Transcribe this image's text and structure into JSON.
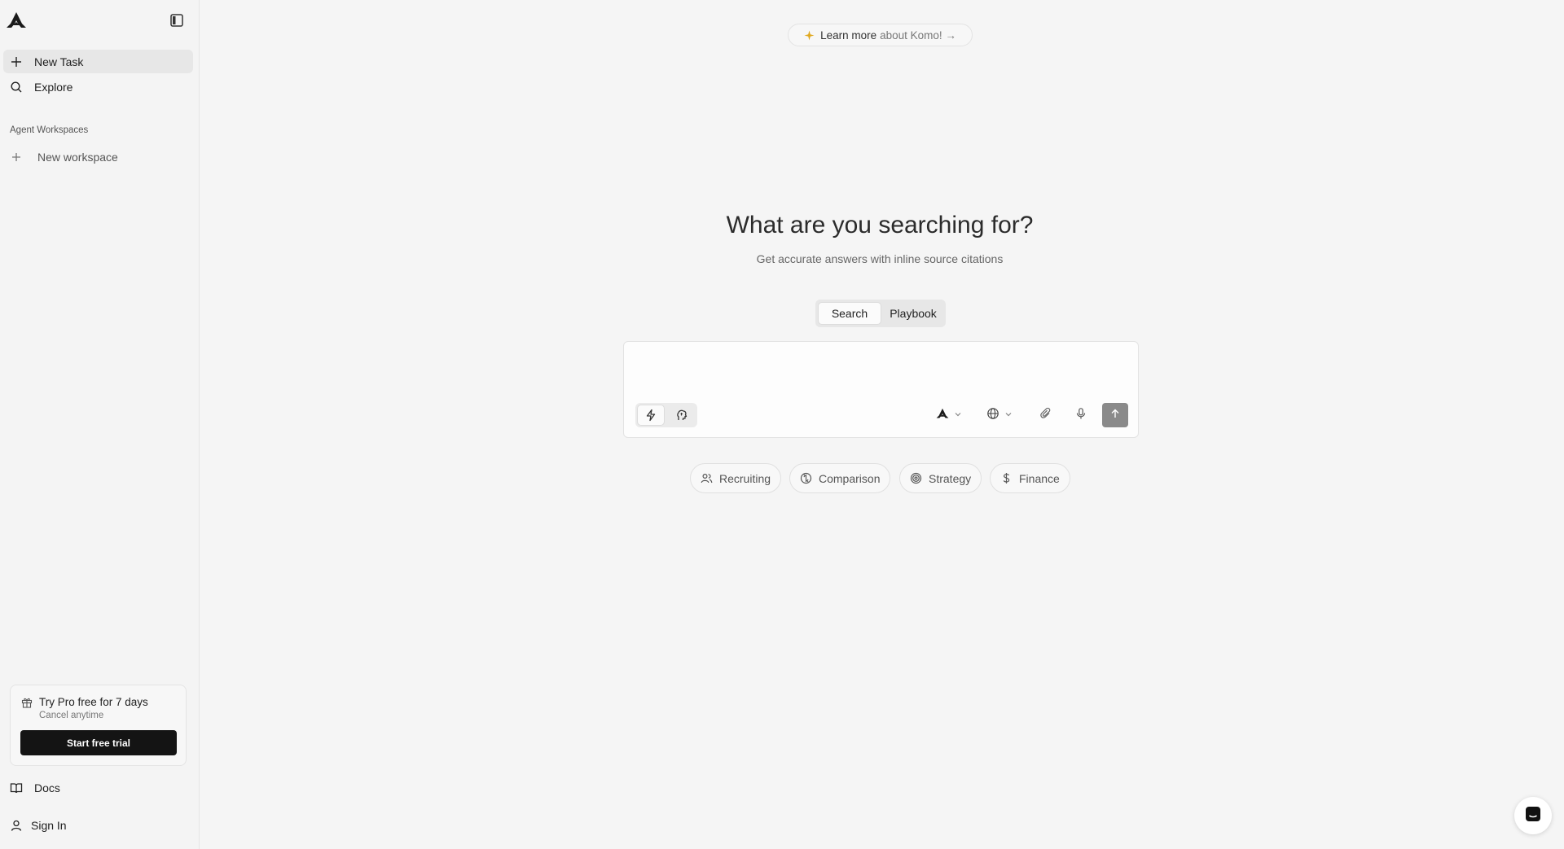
{
  "sidebar": {
    "nav": [
      {
        "label": "New Task",
        "icon": "plus-icon"
      },
      {
        "label": "Explore",
        "icon": "search-icon"
      }
    ],
    "workspaces_label": "Agent Workspaces",
    "new_workspace_label": "New workspace",
    "promo": {
      "title": "Try Pro free for 7 days",
      "subtitle": "Cancel anytime",
      "button": "Start free trial",
      "icon": "gift-icon"
    },
    "footer": [
      {
        "label": "Docs",
        "icon": "book-icon"
      },
      {
        "label": "Sign In",
        "icon": "user-icon"
      }
    ]
  },
  "banner": {
    "bold": "Learn more",
    "rest": "about Komo! →",
    "icon": "sparkle-icon"
  },
  "hero": {
    "title": "What are you searching for?",
    "subtitle": "Get accurate answers with inline source citations"
  },
  "mode_tabs": [
    "Search",
    "Playbook"
  ],
  "composer": {
    "placeholder": "",
    "tools": [
      "komo-model-icon",
      "globe-icon",
      "paperclip-icon",
      "microphone-icon"
    ],
    "send_icon": "arrow-up-icon"
  },
  "chips": [
    {
      "label": "Recruiting",
      "icon": "users-icon"
    },
    {
      "label": "Comparison",
      "icon": "compare-icon"
    },
    {
      "label": "Strategy",
      "icon": "target-icon"
    },
    {
      "label": "Finance",
      "icon": "dollar-icon"
    }
  ],
  "colors": {
    "background": "#f5f5f5",
    "sidebar": "#f4f4f4",
    "primary_button": "#141414",
    "send_button": "#8a8a8a",
    "sparkle": "#e0a81e"
  }
}
